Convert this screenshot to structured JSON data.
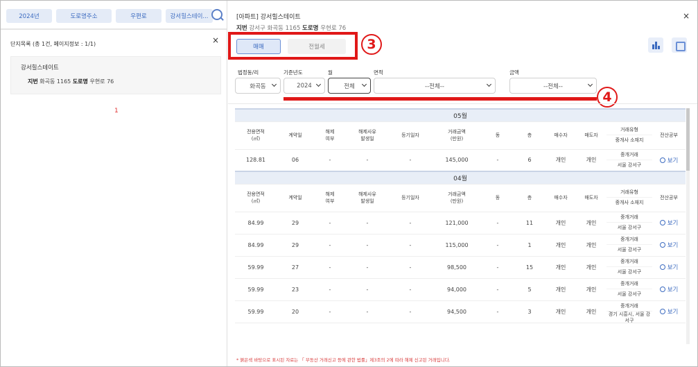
{
  "left": {
    "chips": [
      "2024년",
      "도로명주소",
      "우편로",
      "강서힐스테이..."
    ],
    "list_header": "단지목록 (총 1건, 페이지정보 : 1/1)",
    "close": "×",
    "card": {
      "name": "강서힐스테이트",
      "jibun_label": "지번",
      "jibun": "화곡동 1165",
      "road_label": "도로명",
      "road": "우현로 76"
    },
    "page": "1"
  },
  "right": {
    "title": "[아파트] 강서힐스테이트",
    "addr": {
      "jibun_label": "지번",
      "jibun": "강서구 화곡동 1165",
      "road_label": "도로명",
      "road": "우현로 76"
    },
    "close": "×",
    "tabs": [
      "매매",
      "전월세"
    ],
    "badges": [
      "3",
      "4"
    ],
    "filters": {
      "labels": [
        "법정동/리",
        "기준년도",
        "월",
        "면적",
        "금액"
      ],
      "values": [
        "화곡동",
        "2024",
        "전체",
        "--전체--",
        "--전체--"
      ]
    },
    "columns": [
      "전용면적\n(㎡)",
      "계약일",
      "해제\n여부",
      "해제사유\n발생일",
      "등기일자",
      "거래금액\n(만원)",
      "동",
      "층",
      "매수자",
      "매도자",
      "거래유형|중개사 소재지",
      "전산공부"
    ],
    "view_label": "보기",
    "sections": [
      {
        "month": "05월",
        "rows": [
          [
            "128.81",
            "06",
            "-",
            "-",
            "-",
            "145,000",
            "-",
            "6",
            "개인",
            "개인",
            "중개거래",
            "서울 강서구"
          ]
        ]
      },
      {
        "month": "04월",
        "rows": [
          [
            "84.99",
            "29",
            "-",
            "-",
            "-",
            "121,000",
            "-",
            "11",
            "개인",
            "개인",
            "중개거래",
            "서울 강서구"
          ],
          [
            "84.99",
            "29",
            "-",
            "-",
            "-",
            "115,000",
            "-",
            "1",
            "개인",
            "개인",
            "중개거래",
            "서울 강서구"
          ],
          [
            "59.99",
            "27",
            "-",
            "-",
            "-",
            "98,500",
            "-",
            "15",
            "개인",
            "개인",
            "중개거래",
            "서울 강서구"
          ],
          [
            "59.99",
            "23",
            "-",
            "-",
            "-",
            "94,000",
            "-",
            "5",
            "개인",
            "개인",
            "중개거래",
            "서울 강서구"
          ],
          [
            "59.99",
            "20",
            "-",
            "-",
            "-",
            "94,500",
            "-",
            "3",
            "개인",
            "개인",
            "중개거래",
            "경기 시흥시, 서울 강서구"
          ]
        ]
      }
    ],
    "footnote": "* 붉은색 바탕으로 표시된 자료는 「 부동산 거래신고 등에 관한 법률」제3조의 2에 따라 해제 신고된 거래입니다."
  },
  "colors": {
    "accent": "#3c6bc0",
    "highlight": "#e01818"
  }
}
